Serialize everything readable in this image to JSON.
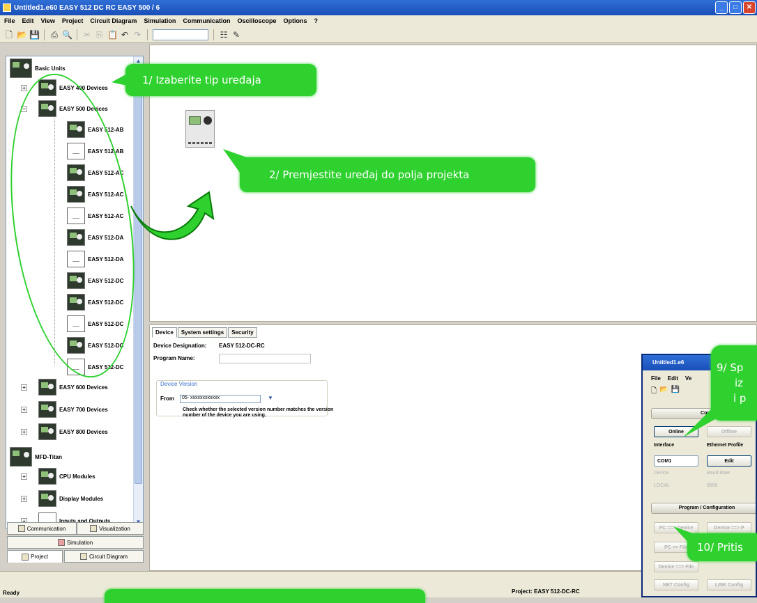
{
  "window": {
    "title": "Untitled1.e60 EASY 512 DC RC   EASY 500 / 6",
    "min": "_",
    "max": "□",
    "close": "✕"
  },
  "menu": [
    "File",
    "Edit",
    "View",
    "Project",
    "Circuit Diagram",
    "Simulation",
    "Communication",
    "Oscilloscope",
    "Options",
    "?"
  ],
  "tree": {
    "root": "Basic Units",
    "groups": {
      "easy400": "EASY 400 Devices",
      "easy500": "EASY 500 Devices",
      "easy600": "EASY 600 Devices",
      "easy700": "EASY 700 Devices",
      "easy800": "EASY 800 Devices",
      "mfd": "MFD-Titan",
      "cpu": "CPU Modules",
      "display": "Display Modules",
      "io": "Inputs and Outputs"
    },
    "devices": [
      "EASY 512-AB",
      "EASY 512-AB",
      "EASY 512-AC",
      "EASY 512-AC",
      "EASY 512-AC",
      "EASY 512-DA",
      "EASY 512-DA",
      "EASY 512-DC",
      "EASY 512-DC",
      "EASY 512-DC",
      "EASY 512-DC",
      "EASY 512-DC"
    ]
  },
  "left_tabs": {
    "communication": "Communication",
    "visualization": "Visualization",
    "simulation": "Simulation",
    "project": "Project",
    "circuit": "Circuit Diagram"
  },
  "props": {
    "tabs": [
      "Device",
      "System settings",
      "Security"
    ],
    "designation_label": "Device Designation:",
    "designation_value": "EASY 512-DC-RC",
    "program_label": "Program Name:",
    "program_value": "",
    "version_title": "Device Version",
    "from_label": "From",
    "from_value": "05- xxxxxxxxxxxx",
    "note": "Check whether the selected version number matches the version number of the device you are using."
  },
  "status": {
    "ready": "Ready",
    "project": "Project: EASY 512-DC-RC"
  },
  "inset": {
    "title": "Untitled1.e6",
    "menu": [
      "File",
      "Edit",
      "Ve"
    ],
    "conn_section": "Conn",
    "online": "Online",
    "offline": "Offline",
    "interface_label": "Interface",
    "ethernet_label": "Ethernet Profile",
    "com_value": "COM1",
    "edit_btn": "Edit",
    "device_label": "Device",
    "baud_label": "Baud Rate",
    "local_value": "LOCAL",
    "baud_value": "9600",
    "program_section": "Program / Configuration",
    "pc_to_device": "PC ==> Device",
    "device_to_pc": "Device ==> P",
    "pc_to_file": "PC <= File",
    "device_to_file": "Device ==> File",
    "net_config": "NET Config",
    "link_config": "LINK Config"
  },
  "callouts": {
    "c1": "1/  Izaberite tip uređaja",
    "c2": "2/  Premjestite uređaj do polja projekta",
    "c9a": "9/  Sp",
    "c9b": "iz",
    "c9c": "i p",
    "c10": "10/  Pritis"
  },
  "colors": {
    "callout": "#2fd12f",
    "title_bar": "#1a4fb8"
  }
}
